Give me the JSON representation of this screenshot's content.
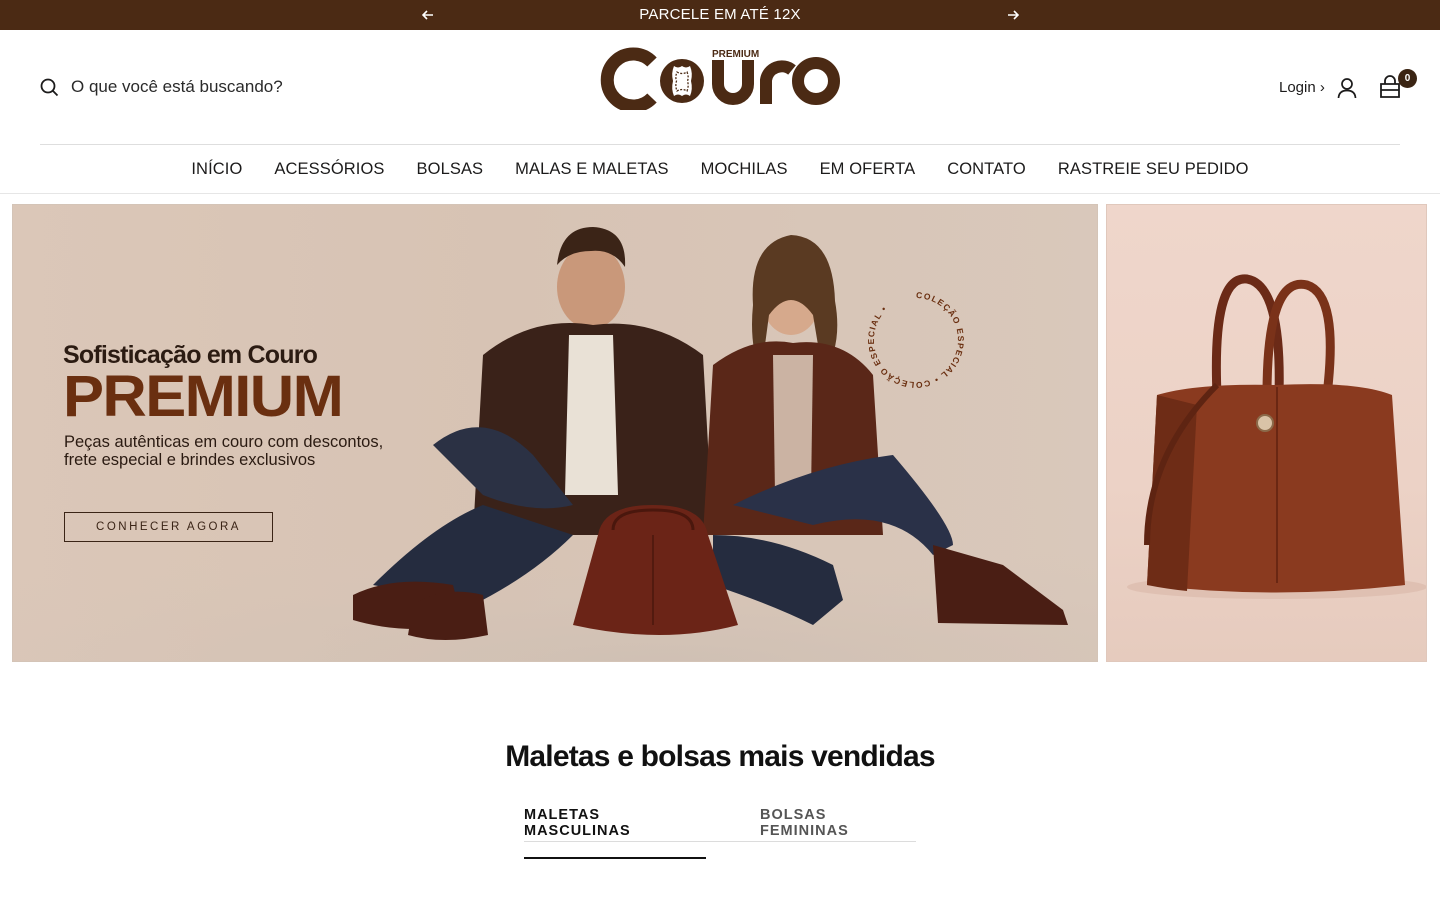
{
  "announcement": {
    "message": "PARCELE EM ATÉ 12X"
  },
  "header": {
    "search_placeholder": "O que você está buscando?",
    "logo": {
      "main": "Couro",
      "tag": "PREMIUM"
    },
    "login_label": "Login ›",
    "cart_count": "0"
  },
  "nav": {
    "items": [
      "INÍCIO",
      "ACESSÓRIOS",
      "BOLSAS",
      "MALAS E MALETAS",
      "MOCHILAS",
      "EM OFERTA",
      "CONTATO",
      "RASTREIE SEU PEDIDO"
    ]
  },
  "hero": {
    "title_line1": "Sofisticação em Couro",
    "title_line2": "PREMIUM",
    "description": "Peças autênticas em couro com descontos, frete especial e brindes exclusivos",
    "button": "CONHECER AGORA",
    "badge_text": "COLEÇÃO ESPECIAL • COLEÇÃO ESPECIAL •"
  },
  "bestsellers": {
    "title": "Maletas e bolsas mais vendidas",
    "tabs": [
      "MALETAS MASCULINAS",
      "BOLSAS FEMININAS"
    ]
  },
  "colors": {
    "brand": "#4b2a14",
    "accent": "#6a2f10"
  }
}
